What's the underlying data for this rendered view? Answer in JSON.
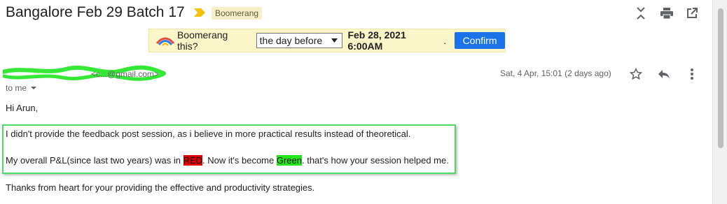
{
  "subject": "Bangalore Feb 29 Batch 17",
  "label": "Boomerang",
  "toolbar_icons": [
    "collapse-icon",
    "print-icon",
    "open-in-new-icon"
  ],
  "boomerang": {
    "question": "Boomerang this?",
    "option": "the day before",
    "date": "Feb 28, 2021 6:00AM",
    "period": ".",
    "confirm": "Confirm"
  },
  "message": {
    "sender_name": "",
    "sender_email": "<c...@gmail.com>",
    "date": "Sat, 4 Apr, 15:01 (2 days ago)",
    "to": "to me",
    "greeting": "Hi Arun,",
    "line1": "I didn't provide the feedback post session, as i believe in more practical results instead of theoretical.",
    "line2_pre": "My overall P&L(since last two years) was in ",
    "line2_red": "RED",
    "line2_mid": ". Now it's become ",
    "line2_green": "Green",
    "line2_post": ". that's how your session helped me.",
    "closing": "Thanks from heart for your providing the effective and productivity strategies."
  },
  "colors": {
    "accent": "#1a73e8",
    "highlight_border": "#4cd964",
    "red": "#e00000",
    "green": "#22e81a"
  }
}
